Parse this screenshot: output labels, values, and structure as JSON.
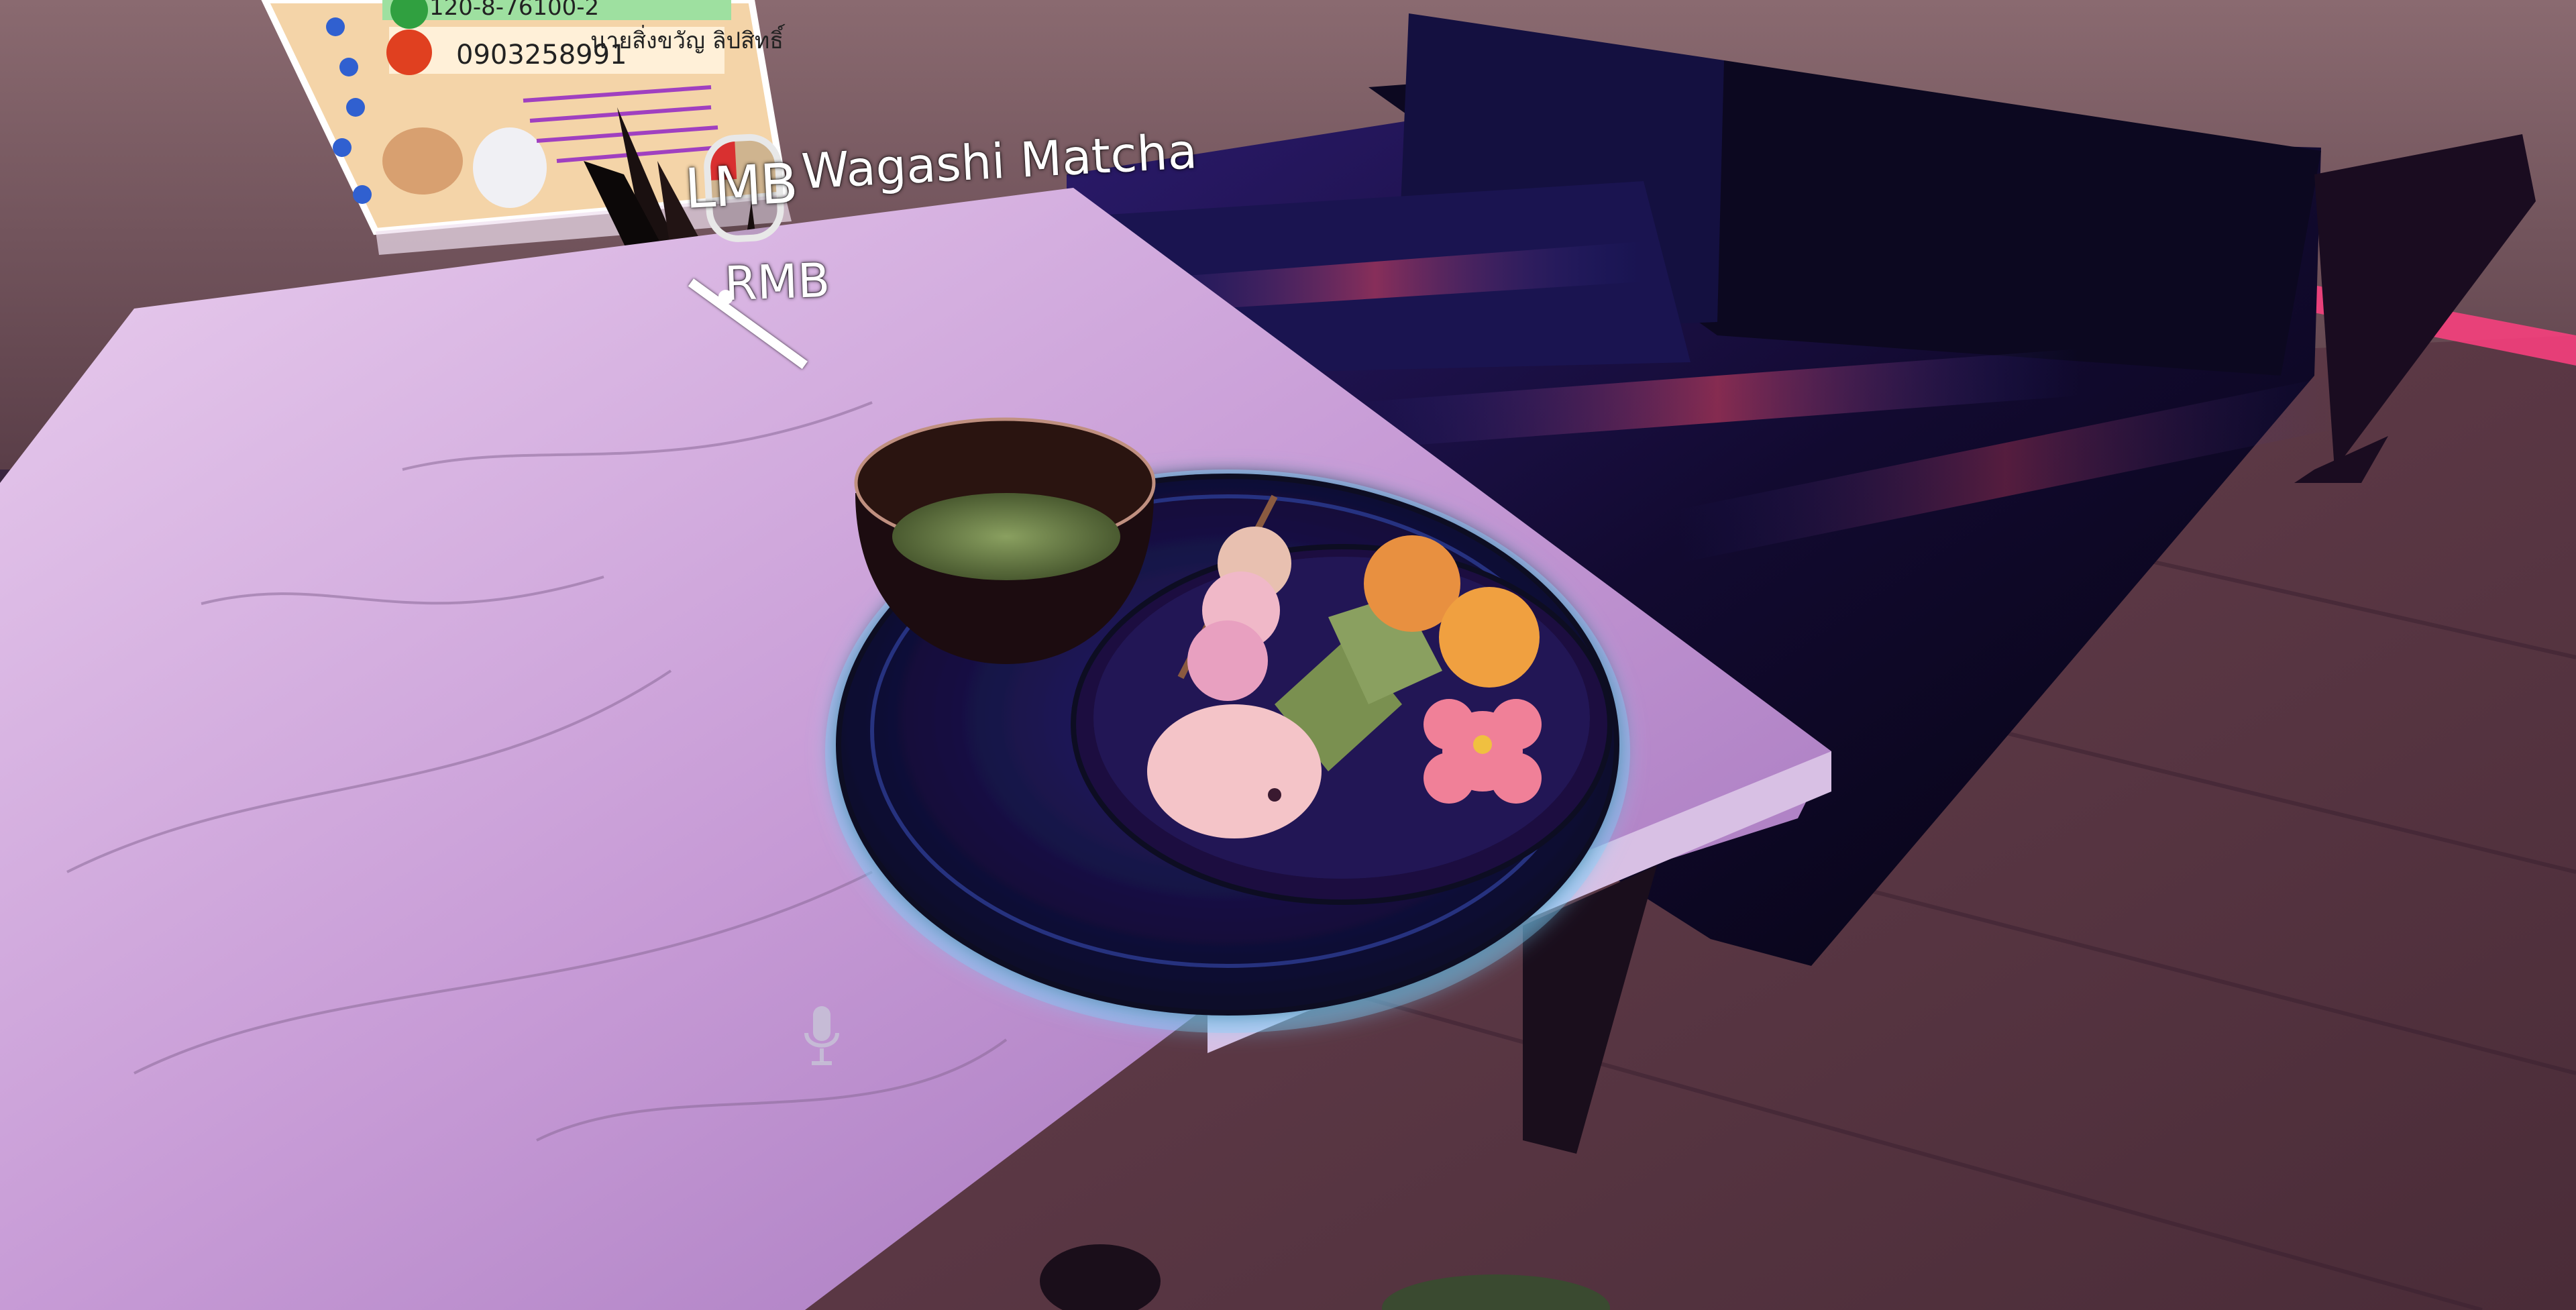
{
  "hud": {
    "interact_key": "LMB",
    "item_name": "Wagashi Matcha",
    "secondary_key": "RMB"
  },
  "icons": {
    "mouse_icon": "mouse-left-button-icon",
    "mic_icon": "microphone-icon"
  },
  "colors": {
    "highlight_glow": "#7fd4ff",
    "table_marble": "#d9b8e6",
    "sofa": "#1a1040",
    "floor": "#5a3a48",
    "wall": "#7a5a60",
    "accent_neon": "#ff4080"
  },
  "poster": {
    "line1": "120-8-76100-2",
    "line2": "0903258991",
    "line3": "นายสิ่งขวัญ ลิปสิทธิ์"
  }
}
